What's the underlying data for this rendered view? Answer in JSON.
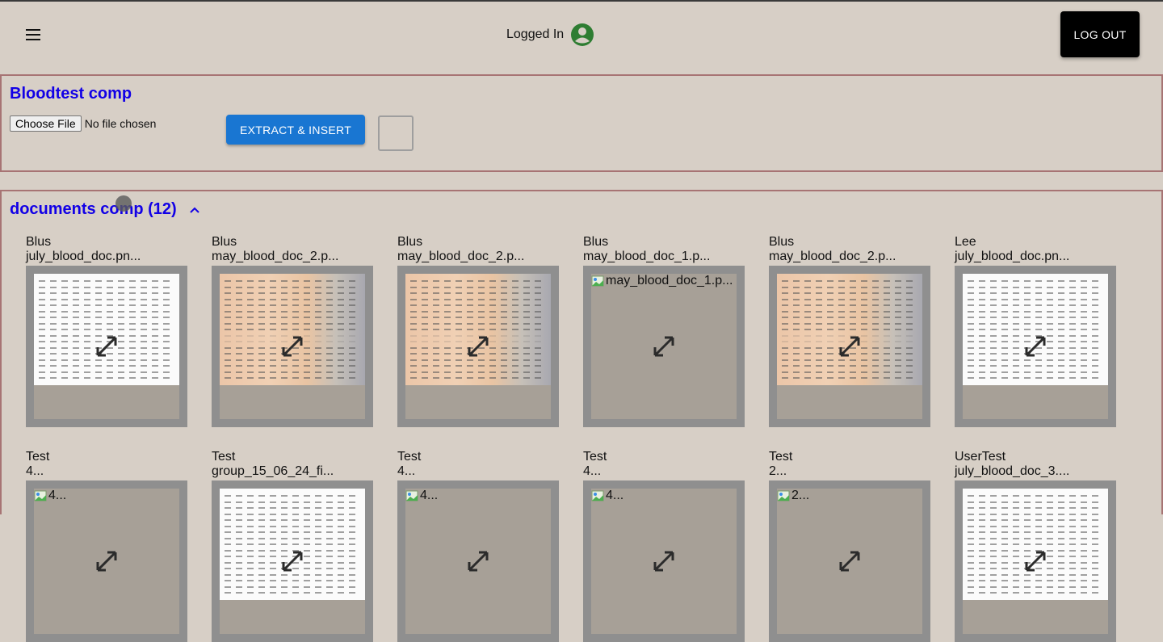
{
  "header": {
    "status_text": "Logged In",
    "logout_label": "LOG OUT",
    "accent_color": "#2e7d32"
  },
  "upload_panel": {
    "title": "Bloodtest comp",
    "choose_file_label": "Choose File",
    "file_status": "No file chosen",
    "extract_label": "EXTRACT & INSERT"
  },
  "documents_panel": {
    "title": "documents comp (12)",
    "items": [
      {
        "owner": "Blus",
        "file": "july_blood_doc.pn...",
        "preview": "scan"
      },
      {
        "owner": "Blus",
        "file": "may_blood_doc_2.p...",
        "preview": "photo"
      },
      {
        "owner": "Blus",
        "file": "may_blood_doc_2.p...",
        "preview": "photo"
      },
      {
        "owner": "Blus",
        "file": "may_blood_doc_1.p...",
        "preview": "broken",
        "alt": "may_blood_doc_1.p..."
      },
      {
        "owner": "Blus",
        "file": "may_blood_doc_2.p...",
        "preview": "photo"
      },
      {
        "owner": "Lee",
        "file": "july_blood_doc.pn...",
        "preview": "scan"
      },
      {
        "owner": "Test",
        "file": "4...",
        "preview": "broken",
        "alt": "4..."
      },
      {
        "owner": "Test",
        "file": "group_15_06_24_fi...",
        "preview": "scan"
      },
      {
        "owner": "Test",
        "file": "4...",
        "preview": "broken",
        "alt": "4..."
      },
      {
        "owner": "Test",
        "file": "4...",
        "preview": "broken",
        "alt": "4..."
      },
      {
        "owner": "Test",
        "file": "2...",
        "preview": "broken",
        "alt": "2..."
      },
      {
        "owner": "UserTest",
        "file": "july_blood_doc_3....",
        "preview": "scan"
      }
    ]
  },
  "icons": {
    "menu": "menu-icon",
    "avatar": "account-circle-icon",
    "collapse": "chevron-up-icon",
    "expand": "expand-icon",
    "broken_image": "broken-image-icon"
  }
}
